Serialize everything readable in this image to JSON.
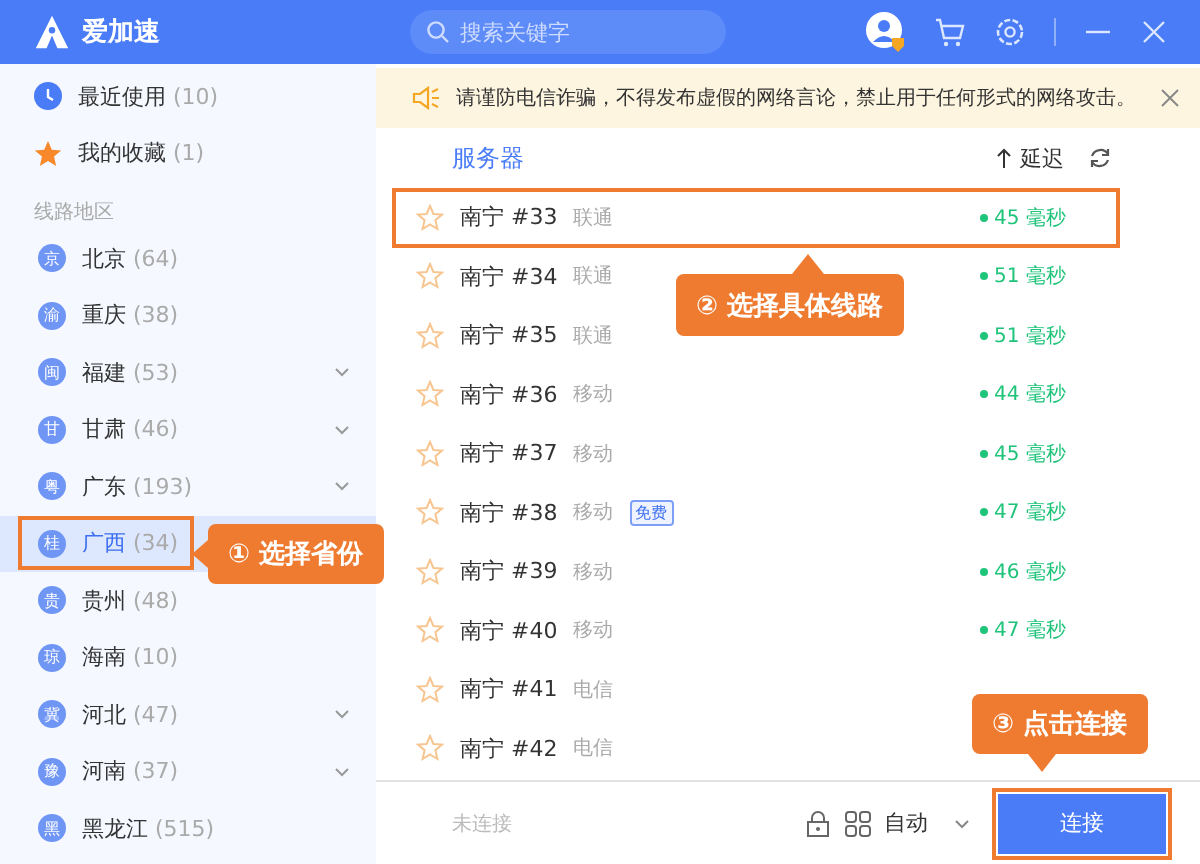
{
  "app": {
    "title": "爱加速"
  },
  "search": {
    "placeholder": "搜索关键字"
  },
  "sidebar": {
    "quick": [
      {
        "kind": "recent",
        "label": "最近使用",
        "count": "(10)"
      },
      {
        "kind": "favorite",
        "label": "我的收藏",
        "count": "(1)"
      }
    ],
    "section_title": "线路地区",
    "regions": [
      {
        "badge": "京",
        "label": "北京",
        "count": "(64)",
        "expandable": false,
        "selected": false,
        "highlighted": false
      },
      {
        "badge": "渝",
        "label": "重庆",
        "count": "(38)",
        "expandable": false,
        "selected": false,
        "highlighted": false
      },
      {
        "badge": "闽",
        "label": "福建",
        "count": "(53)",
        "expandable": true,
        "selected": false,
        "highlighted": false
      },
      {
        "badge": "甘",
        "label": "甘肃",
        "count": "(46)",
        "expandable": true,
        "selected": false,
        "highlighted": false
      },
      {
        "badge": "粤",
        "label": "广东",
        "count": "(193)",
        "expandable": true,
        "selected": false,
        "highlighted": false
      },
      {
        "badge": "桂",
        "label": "广西",
        "count": "(34)",
        "expandable": false,
        "selected": true,
        "highlighted": true
      },
      {
        "badge": "贵",
        "label": "贵州",
        "count": "(48)",
        "expandable": false,
        "selected": false,
        "highlighted": false
      },
      {
        "badge": "琼",
        "label": "海南",
        "count": "(10)",
        "expandable": false,
        "selected": false,
        "highlighted": false
      },
      {
        "badge": "冀",
        "label": "河北",
        "count": "(47)",
        "expandable": true,
        "selected": false,
        "highlighted": false
      },
      {
        "badge": "豫",
        "label": "河南",
        "count": "(37)",
        "expandable": true,
        "selected": false,
        "highlighted": false
      },
      {
        "badge": "黑",
        "label": "黑龙江",
        "count": "(515)",
        "expandable": false,
        "selected": false,
        "highlighted": false
      }
    ]
  },
  "notice": {
    "text": "请谨防电信诈骗，不得发布虚假的网络言论，禁止用于任何形式的网络攻击。"
  },
  "table": {
    "columns": [
      "服务器",
      "延迟"
    ],
    "rows": [
      {
        "name": "南宁 #33",
        "isp": "联通",
        "latency": "45 毫秒",
        "favorite": false,
        "highlighted": true
      },
      {
        "name": "南宁 #34",
        "isp": "联通",
        "latency": "51 毫秒",
        "favorite": false,
        "highlighted": false
      },
      {
        "name": "南宁 #35",
        "isp": "联通",
        "latency": "51 毫秒",
        "favorite": false,
        "highlighted": false
      },
      {
        "name": "南宁 #36",
        "isp": "移动",
        "latency": "44 毫秒",
        "favorite": false,
        "highlighted": false
      },
      {
        "name": "南宁 #37",
        "isp": "移动",
        "latency": "45 毫秒",
        "favorite": false,
        "highlighted": false
      },
      {
        "name": "南宁 #38",
        "isp": "移动",
        "tag": "免费",
        "latency": "47 毫秒",
        "favorite": false,
        "highlighted": false
      },
      {
        "name": "南宁 #39",
        "isp": "移动",
        "latency": "46 毫秒",
        "favorite": false,
        "highlighted": false
      },
      {
        "name": "南宁 #40",
        "isp": "移动",
        "latency": "47 毫秒",
        "favorite": false,
        "highlighted": false
      },
      {
        "name": "南宁 #41",
        "isp": "电信",
        "favorite": false,
        "highlighted": false
      },
      {
        "name": "南宁 #42",
        "isp": "电信",
        "favorite": false,
        "highlighted": false
      }
    ]
  },
  "footer": {
    "status": "未连接",
    "mode": "自动",
    "connect_button": "连接",
    "connect_highlighted": true
  },
  "callouts": [
    {
      "kind": "region",
      "text": "① 选择省份"
    },
    {
      "kind": "row",
      "text": "② 选择具体线路"
    },
    {
      "kind": "connect",
      "text": "③ 点击连接"
    }
  ]
}
